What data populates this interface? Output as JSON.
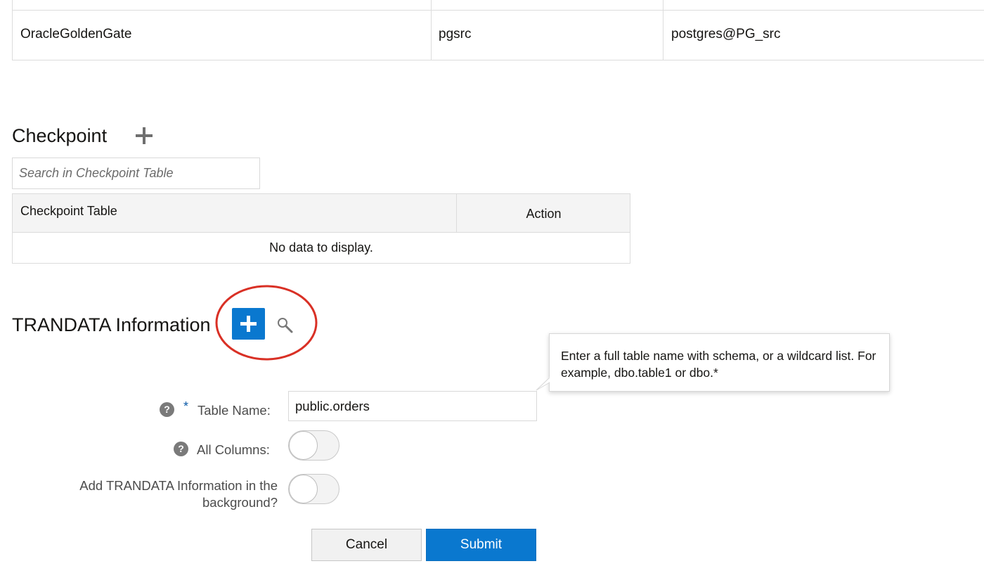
{
  "credentials_table": {
    "row": {
      "domain": "OracleGoldenGate",
      "alias": "pgsrc",
      "user_id": "postgres@PG_src"
    }
  },
  "checkpoint": {
    "title": "Checkpoint",
    "add_icon": "plus-icon",
    "search_placeholder": "Search in Checkpoint Table",
    "columns": [
      "Checkpoint Table",
      "Action"
    ],
    "empty_message": "No data to display."
  },
  "trandata": {
    "title": "TRANDATA Information",
    "add_icon": "plus-icon",
    "search_icon": "magnifier-icon",
    "highlight_color": "#d93025",
    "tooltip": "Enter a full table name with schema, or a wildcard list. For example, dbo.table1 or dbo.*",
    "form": {
      "table_name_label": "Table Name:",
      "required_mark": "*",
      "table_name_value": "public.orders",
      "all_columns_label": "All Columns:",
      "all_columns_on": false,
      "background_label_line1": "Add TRANDATA Information in the",
      "background_label_line2": "background?",
      "background_on": false,
      "help_icon": "question-circle-icon"
    },
    "buttons": {
      "cancel": "Cancel",
      "submit": "Submit"
    }
  },
  "colors": {
    "accent": "#0a78cf",
    "help_icon": "#7a7a7a",
    "border": "#dcdcdc"
  }
}
